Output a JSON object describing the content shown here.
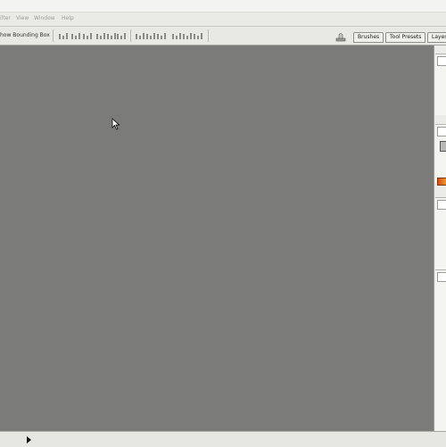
{
  "menu": {
    "items": [
      "ilter",
      "View",
      "Window",
      "Help"
    ]
  },
  "options_bar": {
    "show_bounding_box_label": "how Bounding Box"
  },
  "palette_well": {
    "tabs": [
      "Brushes",
      "Tool Presets",
      "Layer"
    ]
  },
  "colors": {
    "canvas": "#7b7b79",
    "chrome": "#e8e8e4",
    "gradient_start": "#d84a1a",
    "gradient_end": "#f0a030"
  }
}
